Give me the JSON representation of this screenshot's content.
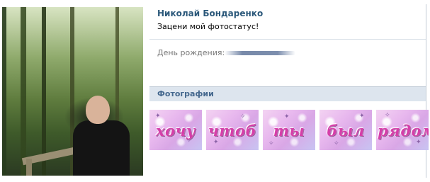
{
  "profile": {
    "name": "Николай Бондаренко",
    "status": "Зацени мой фотостатус!",
    "birthday_label": "День рождения:"
  },
  "photos": {
    "header": "Фотографии",
    "items": [
      "хочу",
      "чтоб",
      "ты",
      "был",
      "рядом"
    ]
  },
  "colors": {
    "name": "#2b587a",
    "photos_header_bg": "#dde5ee",
    "photos_header_text": "#45688e",
    "photo_word": "#d53fa9"
  }
}
